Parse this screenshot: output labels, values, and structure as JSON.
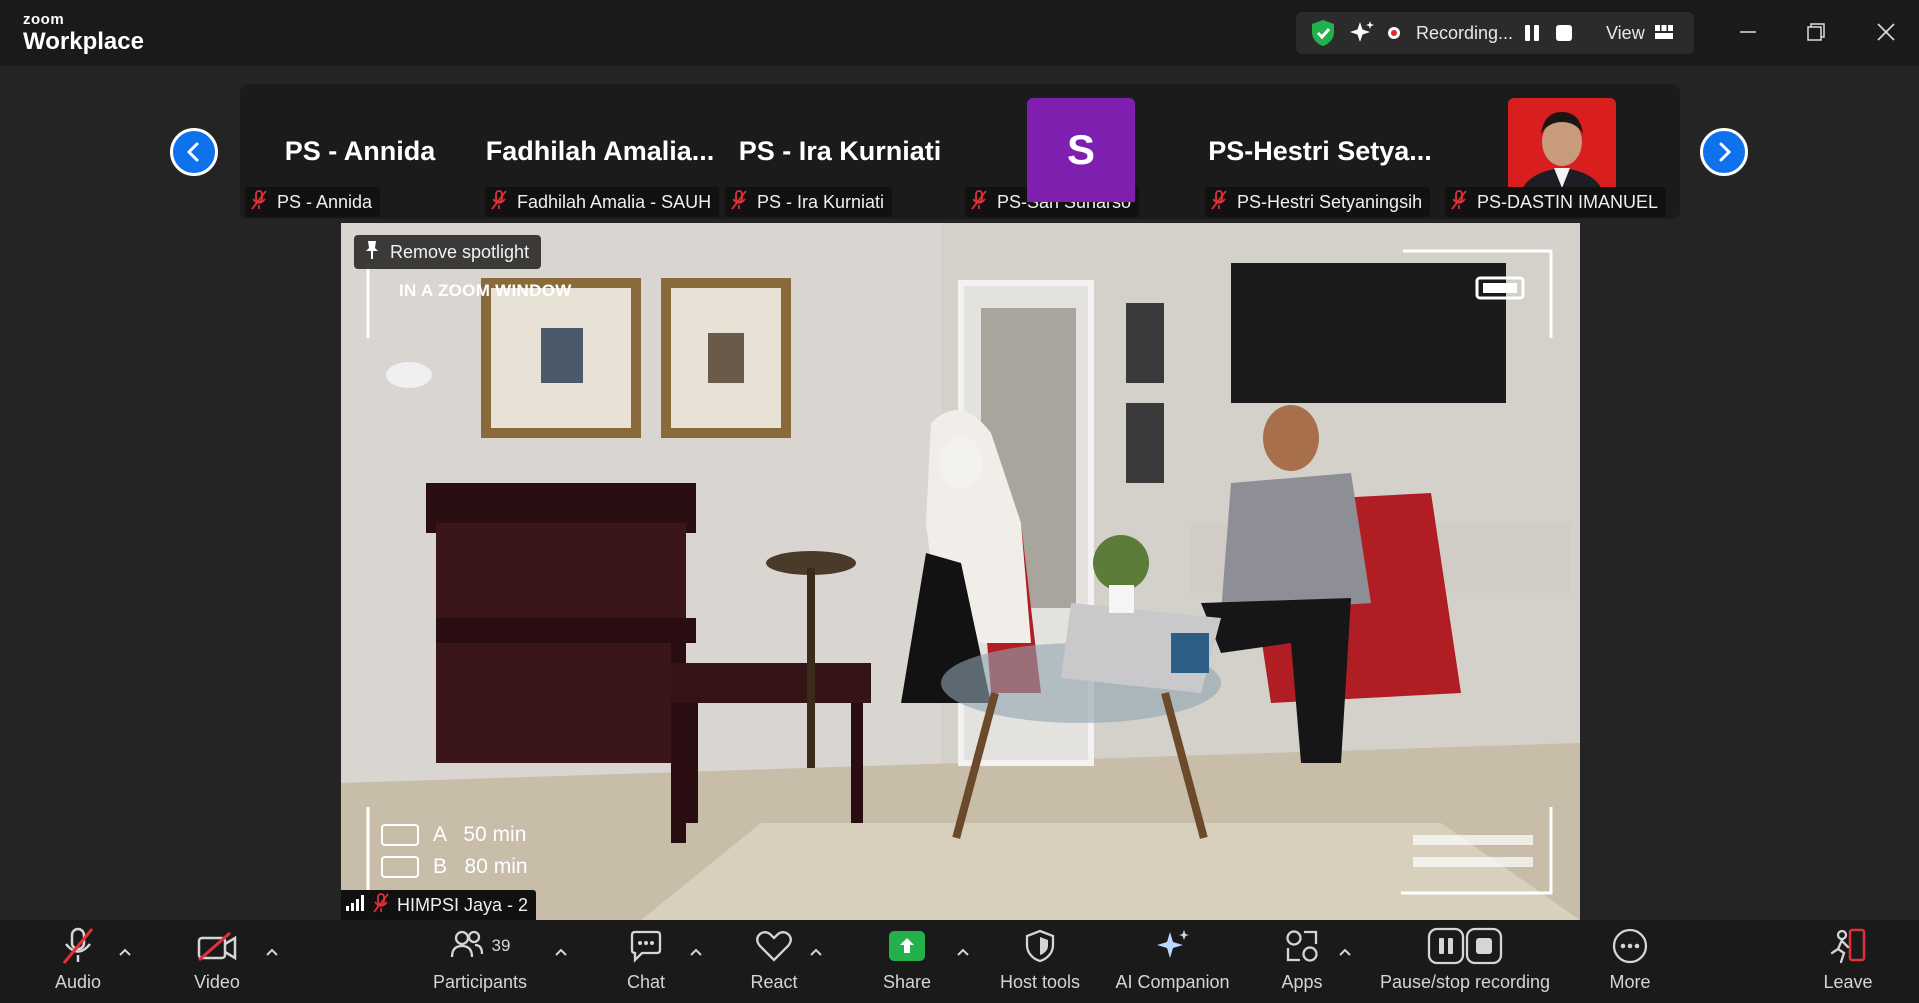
{
  "app": {
    "brand_small": "zoom",
    "brand_large": "Workplace"
  },
  "titlebar": {
    "recording_text": "Recording...",
    "view_label": "View"
  },
  "thumbnails": [
    {
      "display": "PS - Annida",
      "name": "PS - Annida"
    },
    {
      "display": "Fadhilah  Amalia...",
      "name": "Fadhilah Amalia - SAUH"
    },
    {
      "display": "PS - Ira Kurniati",
      "name": "PS - Ira Kurniati"
    },
    {
      "display": "S",
      "name": "PS-Sari Suharso"
    },
    {
      "display": "PS-Hestri  Setya...",
      "name": "PS-Hestri Setyaningsih"
    },
    {
      "display": "",
      "name": "PS-DASTIN IMANUEL"
    }
  ],
  "video": {
    "spotlight_button": "Remove spotlight",
    "overlay_text": "IN A ZOOM WINDOW",
    "timer_a": "A   50 min",
    "timer_b": "B   80 min",
    "name": "HIMPSI Jaya - 2"
  },
  "toolbar": {
    "audio": "Audio",
    "video": "Video",
    "participants": "Participants",
    "participants_count": "39",
    "chat": "Chat",
    "react": "React",
    "share": "Share",
    "host_tools": "Host tools",
    "ai_companion": "AI Companion",
    "apps": "Apps",
    "pause_stop": "Pause/stop recording",
    "more": "More",
    "leave": "Leave"
  },
  "colors": {
    "accent_blue": "#0e72ed",
    "share_green": "#24b04b",
    "muted_red": "#e0313a",
    "avatar_purple": "#7e1fb0"
  }
}
